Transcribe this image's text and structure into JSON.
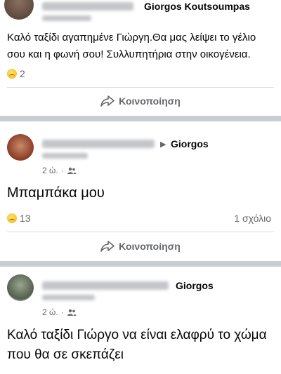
{
  "posts": [
    {
      "author_target": "Giorgos Koutsoumpas",
      "text": "Καλό ταξίδι αγαπημένε Γιώργη.Θα μας λείψει το γέλιο σου και η φωνή σου! Συλλυπητήρια στην οικογένεια.",
      "reaction_count": "2",
      "share_label": "Κοινοποίηση"
    },
    {
      "author_target": "Giorgos",
      "time": "2 ώ.",
      "text": "Μπαμπάκα μου",
      "reaction_count": "13",
      "comment_count": "1 σχόλιο",
      "share_label": "Κοινοποίηση"
    },
    {
      "author_target": "Giorgos",
      "time": "2 ώ.",
      "text": "Καλό ταξίδι Γιώργο να είναι ελαφρύ το χώμα που θα σε σκεπάζει"
    }
  ],
  "icons": {
    "reaction": "sad-face-icon",
    "share": "share-arrow-icon",
    "audience": "friends-icon",
    "separator": "·",
    "to": "▶"
  },
  "colors": {
    "background": "#c9ccd1",
    "card": "#ffffff",
    "secondary_text": "#65676b"
  }
}
